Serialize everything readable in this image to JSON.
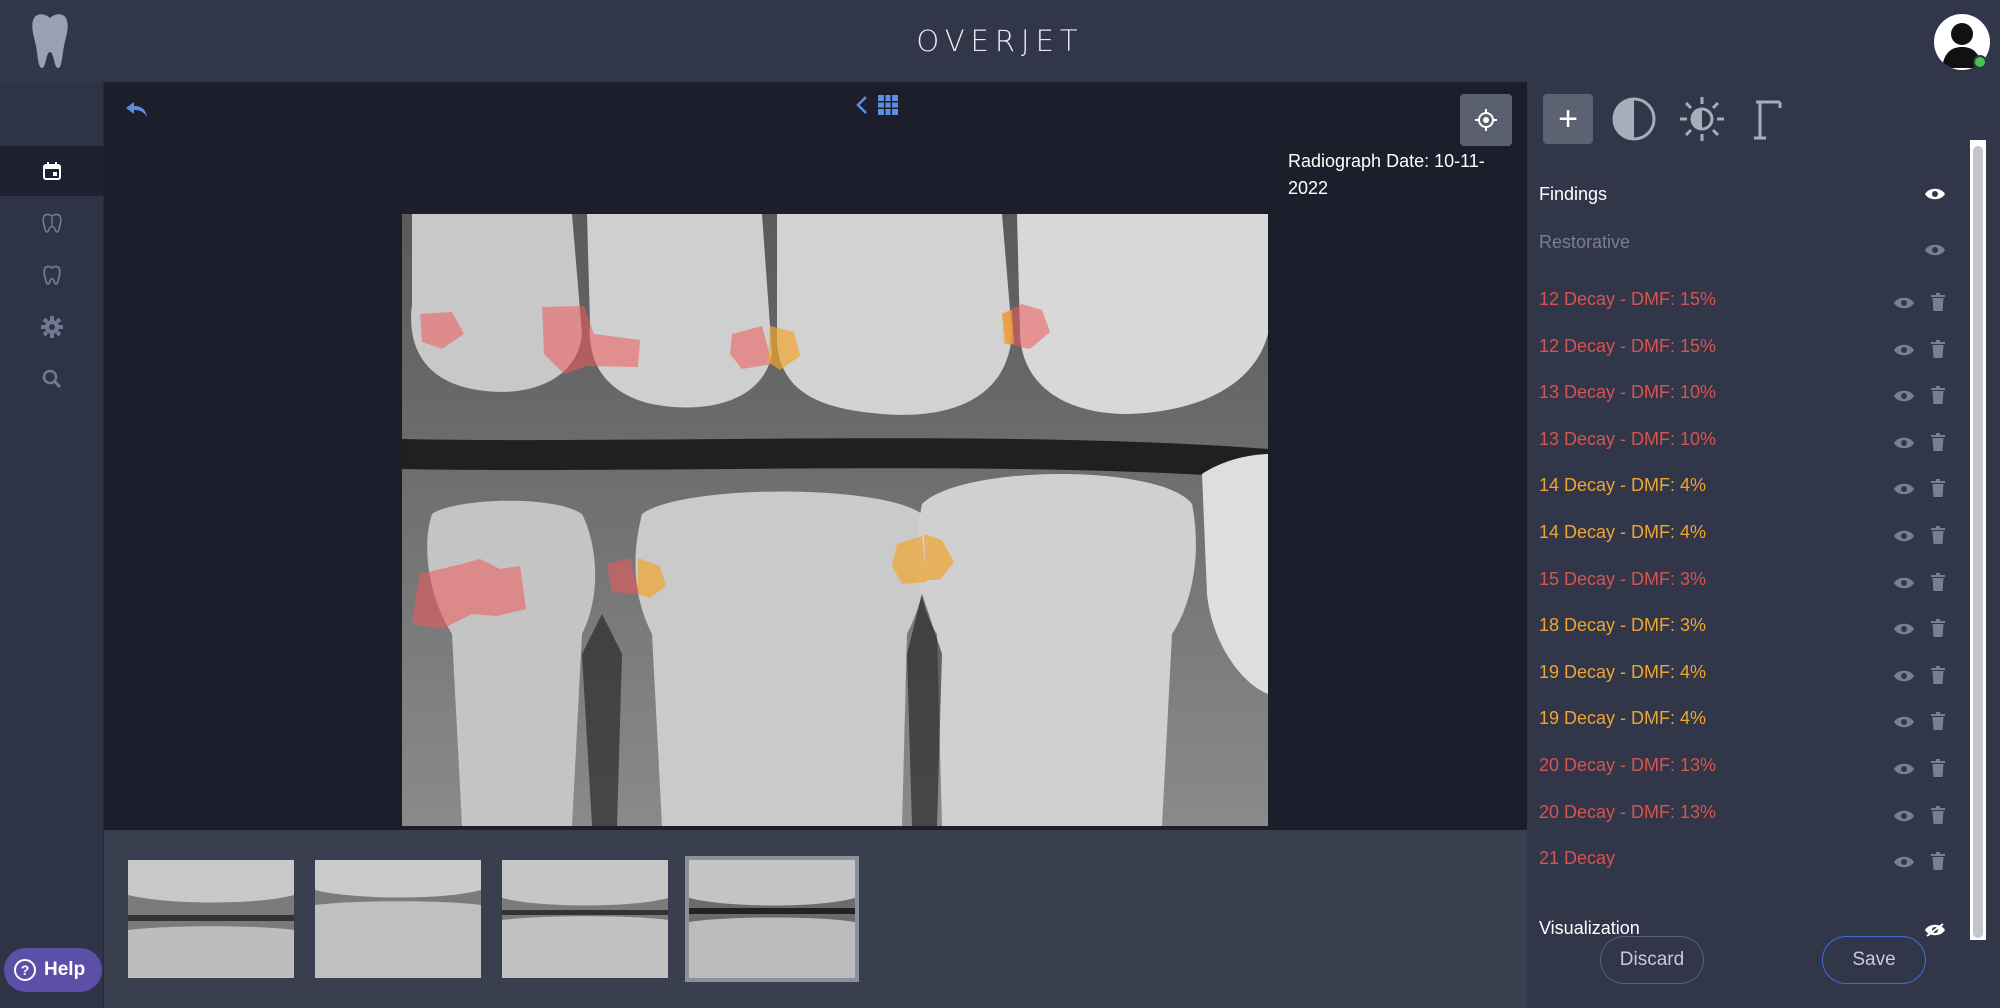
{
  "header": {
    "brand": "OVERJET"
  },
  "viewer": {
    "radiograph_date": "Radiograph Date: 10-11-2022"
  },
  "sidebar": {
    "items": [
      {
        "icon": "calendar-icon",
        "active": true
      },
      {
        "icon": "teeth-chart-icon",
        "active": false
      },
      {
        "icon": "tooth-icon",
        "active": false
      },
      {
        "icon": "gear-icon",
        "active": false
      },
      {
        "icon": "search-icon",
        "active": false
      }
    ],
    "help_label": "Help"
  },
  "panel": {
    "tools": [
      "add-icon",
      "contrast-icon",
      "brightness-icon",
      "gamma-icon"
    ],
    "findings_title": "Findings",
    "restorative_label": "Restorative",
    "findings": [
      {
        "label": "12 Decay - DMF: 15%",
        "color": "#d9534f"
      },
      {
        "label": "12 Decay - DMF: 15%",
        "color": "#d9534f"
      },
      {
        "label": "13 Decay - DMF: 10%",
        "color": "#d9534f"
      },
      {
        "label": "13 Decay - DMF: 10%",
        "color": "#d9534f"
      },
      {
        "label": "14 Decay - DMF: 4%",
        "color": "#f0a530"
      },
      {
        "label": "14 Decay - DMF: 4%",
        "color": "#f0a530"
      },
      {
        "label": "15 Decay - DMF: 3%",
        "color": "#d9534f"
      },
      {
        "label": "18 Decay - DMF: 3%",
        "color": "#f0a530"
      },
      {
        "label": "19 Decay - DMF: 4%",
        "color": "#f0a530"
      },
      {
        "label": "19 Decay - DMF: 4%",
        "color": "#f0a530"
      },
      {
        "label": "20 Decay - DMF: 13%",
        "color": "#d9534f"
      },
      {
        "label": "20 Decay - DMF: 13%",
        "color": "#d9534f"
      },
      {
        "label": "21 Decay",
        "color": "#d9534f"
      }
    ],
    "visualization_title": "Visualization",
    "discard_label": "Discard",
    "save_label": "Save"
  },
  "thumbnails": [
    {
      "selected": false
    },
    {
      "selected": false
    },
    {
      "selected": false
    },
    {
      "selected": true
    }
  ]
}
